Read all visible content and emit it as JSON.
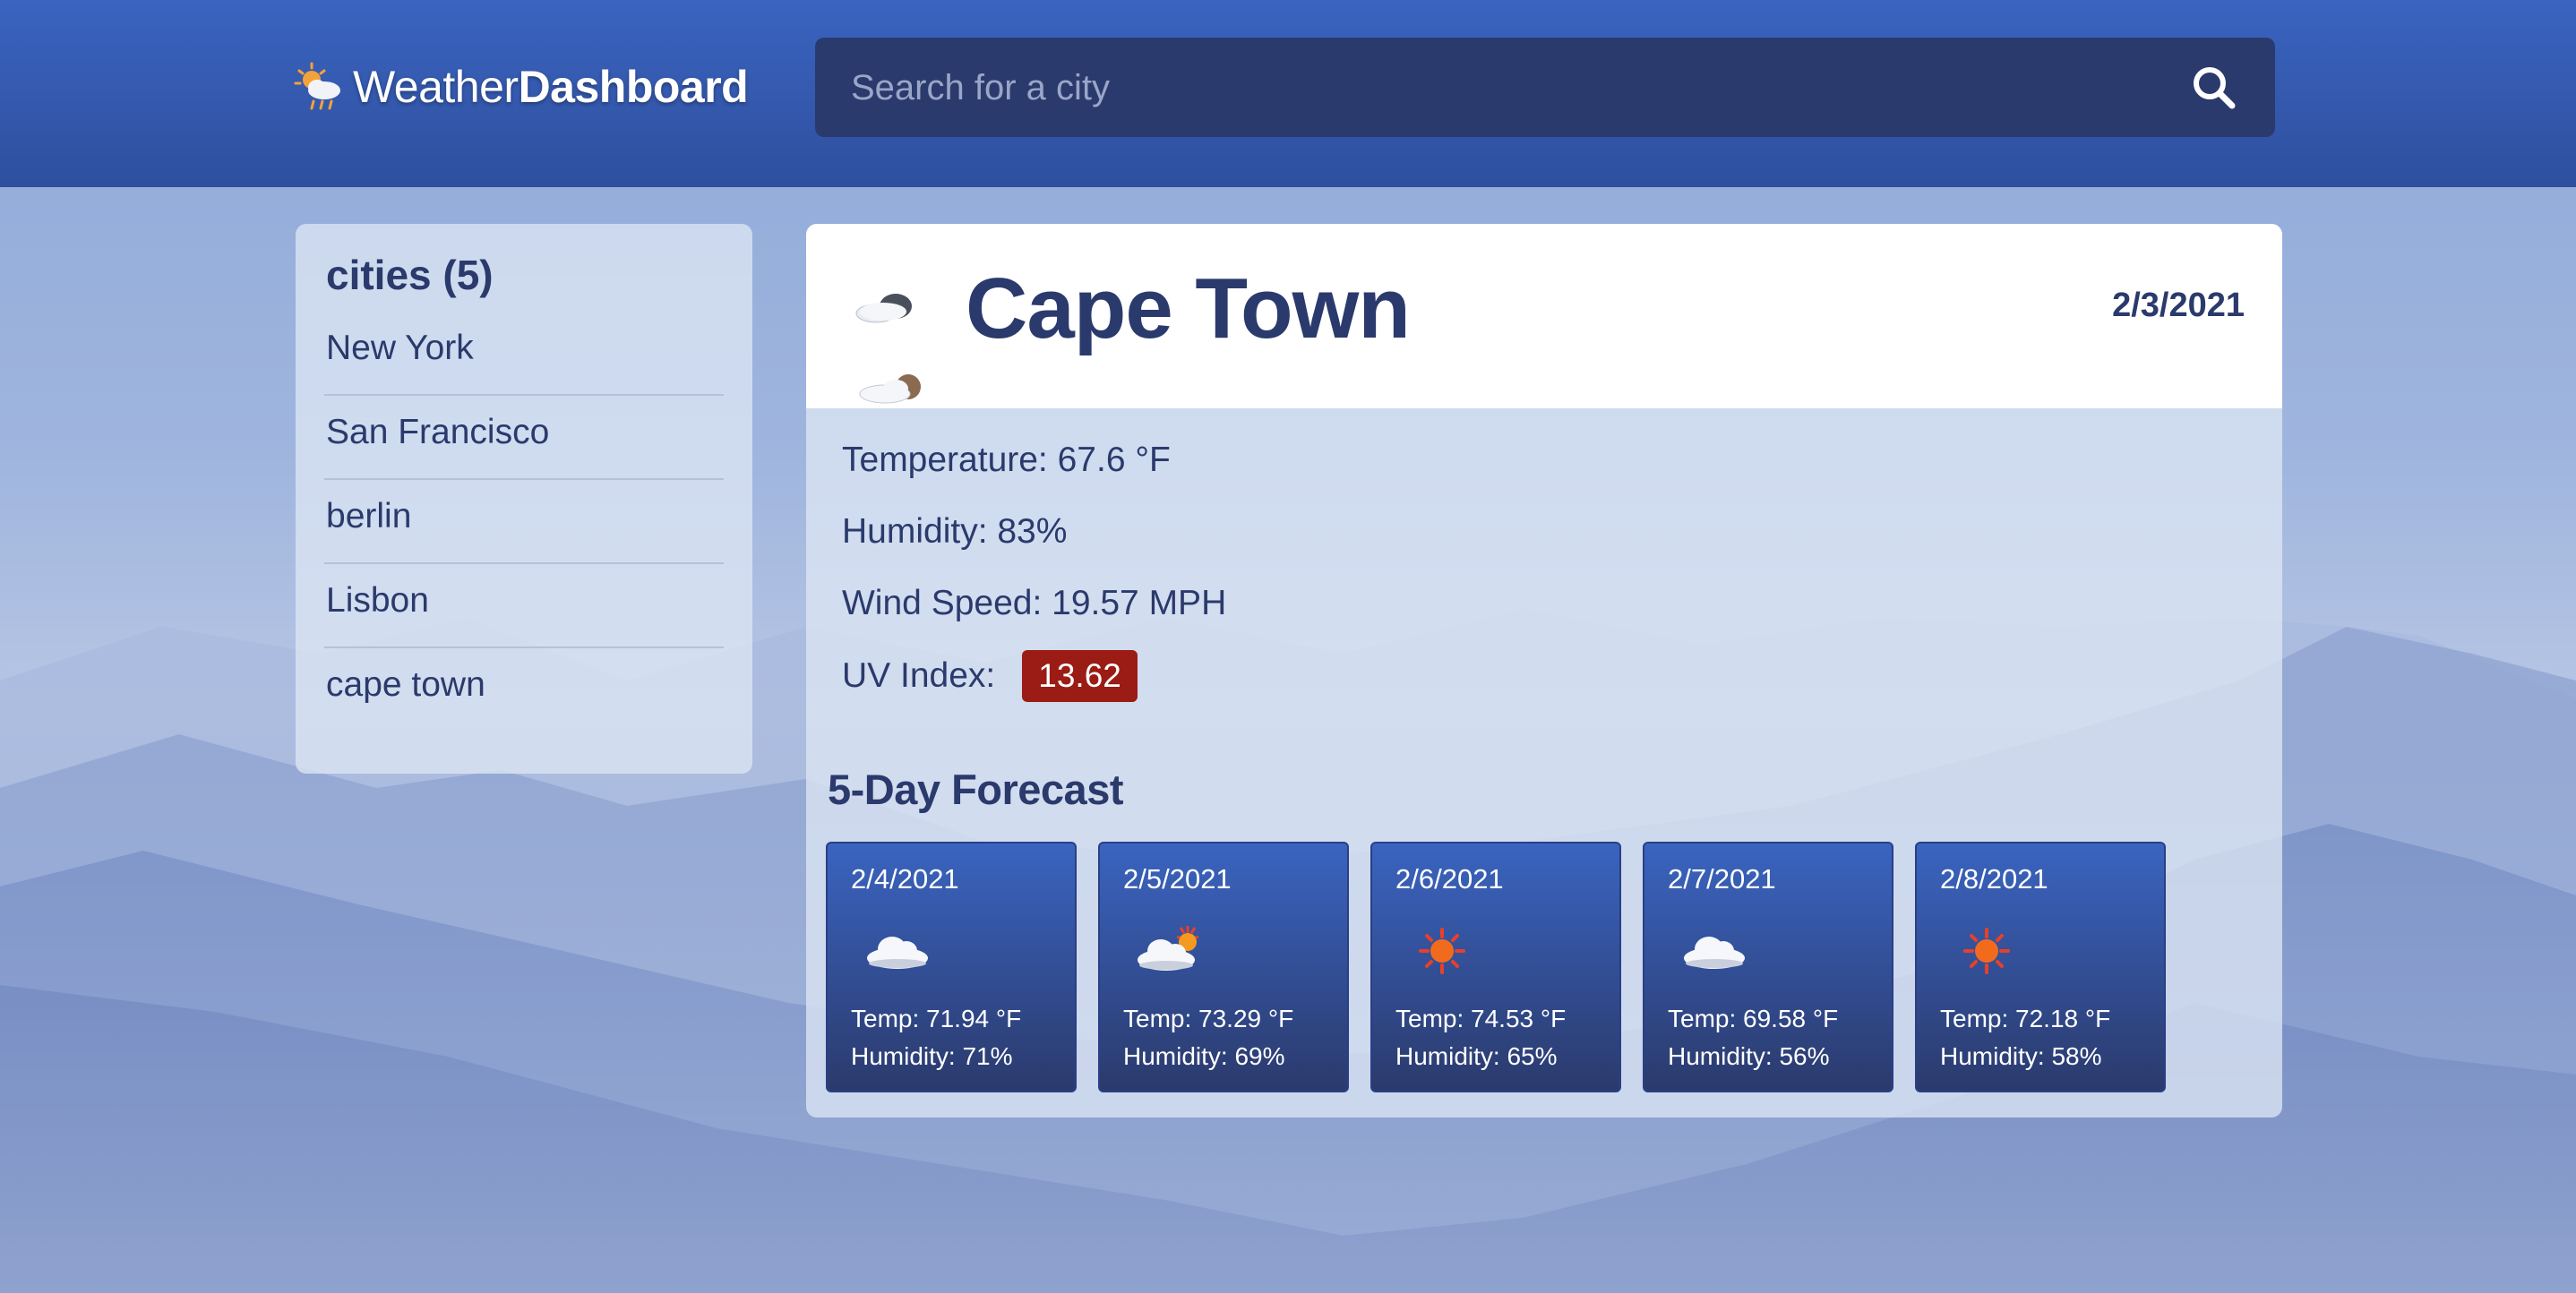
{
  "app": {
    "logo_regular": "Weather",
    "logo_bold": "Dashboard"
  },
  "search": {
    "placeholder": "Search for a city",
    "icon": "search-icon"
  },
  "sidebar": {
    "title": "cities (5)",
    "cities": [
      "New York",
      "San Francisco",
      "berlin",
      "Lisbon",
      "cape town"
    ]
  },
  "current": {
    "city": "Cape Town",
    "date": "2/3/2021",
    "icon": "cloud-night-icon",
    "temperature": "Temperature: 67.6 °F",
    "humidity": "Humidity: 83%",
    "wind": "Wind Speed: 19.57 MPH",
    "uv_label": "UV Index:",
    "uv_value": "13.62",
    "uv_color": "#9b1c14"
  },
  "forecast": {
    "title": "5-Day Forecast",
    "days": [
      {
        "date": "2/4/2021",
        "icon": "cloud-icon",
        "temp": "Temp: 71.94 °F",
        "humidity": "Humidity: 71%"
      },
      {
        "date": "2/5/2021",
        "icon": "sun-behind-cloud-icon",
        "temp": "Temp: 73.29 °F",
        "humidity": "Humidity: 69%"
      },
      {
        "date": "2/6/2021",
        "icon": "sun-icon",
        "temp": "Temp: 74.53 °F",
        "humidity": "Humidity: 65%"
      },
      {
        "date": "2/7/2021",
        "icon": "cloud-icon",
        "temp": "Temp: 69.58 °F",
        "humidity": "Humidity: 56%"
      },
      {
        "date": "2/8/2021",
        "icon": "sun-icon",
        "temp": "Temp: 72.18 °F",
        "humidity": "Humidity: 58%"
      }
    ]
  },
  "colors": {
    "header": "#2f4f9e",
    "search_bg": "#2b3a6c",
    "text_dark": "#2b3a6c",
    "card_top": "#3a64c0",
    "card_bottom": "#2b3a6c"
  }
}
